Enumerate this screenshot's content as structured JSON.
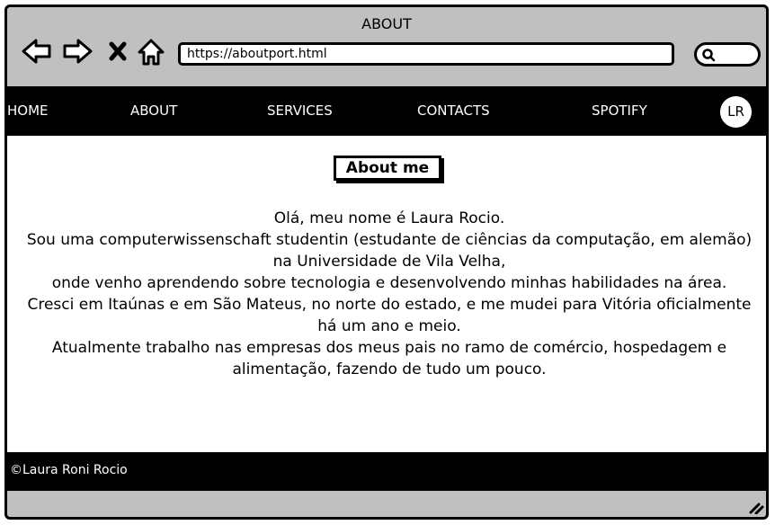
{
  "window": {
    "title": "ABOUT"
  },
  "toolbar": {
    "back_icon": "back-arrow-icon",
    "forward_icon": "forward-arrow-icon",
    "close_icon": "close-icon",
    "home_icon": "home-icon",
    "url": "https://aboutport.html",
    "search_icon": "search-icon"
  },
  "navbar": {
    "items": [
      {
        "label": "HOME"
      },
      {
        "label": "ABOUT"
      },
      {
        "label": "SERVICES"
      },
      {
        "label": "CONTACTS"
      },
      {
        "label": "SPOTIFY"
      }
    ],
    "avatar_initials": "LR"
  },
  "main": {
    "heading": "About me",
    "paragraphs": [
      "Olá, meu nome é Laura Rocio.",
      "Sou uma computerwissenschaft studentin (estudante de ciências da computação, em alemão) na Universidade de Vila Velha,",
      "onde venho aprendendo sobre tecnologia e desenvolvendo minhas habilidades na área.",
      "Cresci em Itaúnas e em São Mateus, no norte do estado, e me mudei para Vitória oficialmente há um ano e meio.",
      "Atualmente trabalho nas empresas dos meus pais no ramo de comércio, hospedagem e alimentação, fazendo de tudo um pouco."
    ]
  },
  "footer": {
    "copyright": "©Laura Roni Rocio"
  },
  "colors": {
    "window_chrome": "#c0c0c0",
    "bar_background": "#000000",
    "content_background": "#ffffff",
    "text_light": "#ffffff",
    "text_dark": "#000000"
  }
}
